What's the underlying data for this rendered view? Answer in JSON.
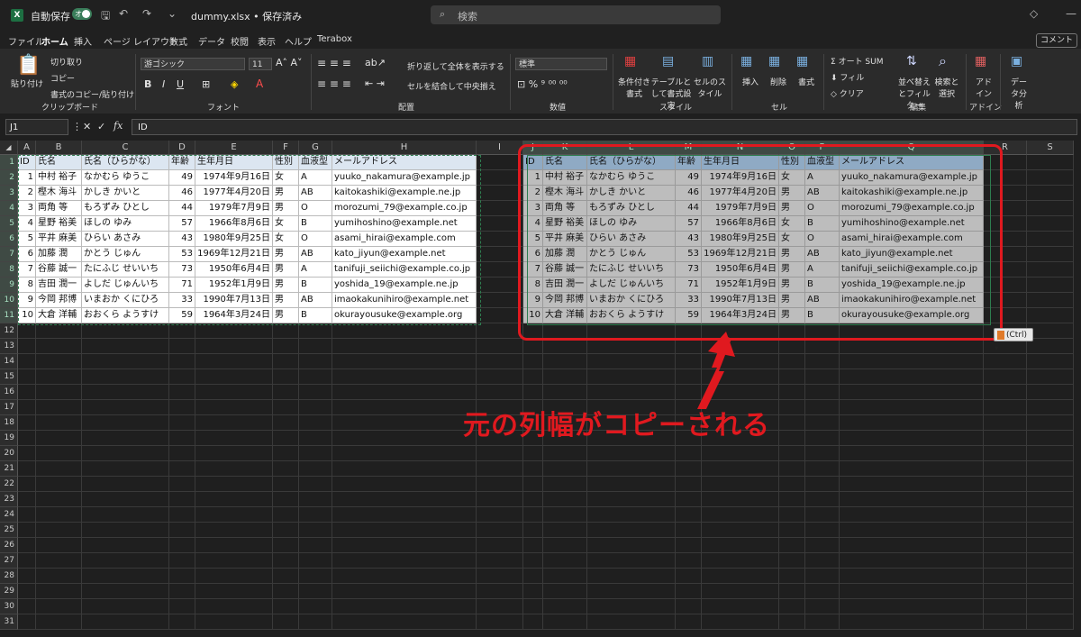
{
  "titlebar": {
    "autosave_label": "自動保存",
    "autosave_state": "オン",
    "filename": "dummy.xlsx • 保存済み",
    "search_placeholder": "検索"
  },
  "menu": {
    "tabs": [
      "ファイル",
      "ホーム",
      "挿入",
      "ページ レイアウト",
      "数式",
      "データ",
      "校閲",
      "表示",
      "ヘルプ",
      "Terabox"
    ],
    "active": "ホーム",
    "share": "コメント"
  },
  "ribbon": {
    "clipboard": {
      "paste": "貼り付け",
      "cut": "切り取り",
      "copy": "コピー",
      "format_painter": "書式のコピー/貼り付け",
      "label": "クリップボード"
    },
    "font": {
      "name": "游ゴシック",
      "size": "11",
      "label": "フォント"
    },
    "alignment": {
      "wrap": "折り返して全体を表示する",
      "merge": "セルを結合して中央揃え",
      "label": "配置"
    },
    "number": {
      "format": "標準",
      "label": "数値"
    },
    "styles": {
      "conditional": "条件付き書式",
      "table": "テーブルとして書式設定",
      "cell": "セルのスタイル",
      "label": "スタイル"
    },
    "cells": {
      "insert": "挿入",
      "delete": "削除",
      "format": "書式",
      "label": "セル"
    },
    "editing": {
      "autosum": "オート SUM",
      "fill": "フィル",
      "clear": "クリア",
      "sort": "並べ替えとフィルター",
      "find": "検索と選択",
      "label": "編集"
    },
    "addins": {
      "addin": "アドイン",
      "label": "アドイン"
    },
    "analysis": {
      "label": "データ分析"
    }
  },
  "formula_bar": {
    "name_box": "J1",
    "fx": "fx",
    "value": "ID"
  },
  "grid": {
    "columns_src": [
      "A",
      "B",
      "C",
      "D",
      "E",
      "F",
      "G",
      "H",
      "I"
    ],
    "columns_dst": [
      "J",
      "K",
      "L",
      "M",
      "N",
      "O",
      "P",
      "Q",
      "R",
      "S"
    ],
    "rows": [
      "1",
      "2",
      "3",
      "4",
      "5",
      "6",
      "7",
      "8",
      "9",
      "10",
      "11",
      "12",
      "13",
      "14",
      "15",
      "16",
      "17",
      "18",
      "19",
      "20",
      "21",
      "22",
      "23",
      "24",
      "25",
      "26",
      "27",
      "28",
      "29",
      "30",
      "31"
    ],
    "header": [
      "ID",
      "氏名",
      "氏名（ひらがな）",
      "年齢",
      "生年月日",
      "性別",
      "血液型",
      "メールアドレス"
    ],
    "records": [
      [
        "1",
        "中村 裕子",
        "なかむら ゆうこ",
        "49",
        "1974年9月16日",
        "女",
        "A",
        "yuuko_nakamura@example.jp"
      ],
      [
        "2",
        "樫木 海斗",
        "かしき かいと",
        "46",
        "1977年4月20日",
        "男",
        "AB",
        "kaitokashiki@example.ne.jp"
      ],
      [
        "3",
        "両角 等",
        "もろずみ ひとし",
        "44",
        "1979年7月9日",
        "男",
        "O",
        "morozumi_79@example.co.jp"
      ],
      [
        "4",
        "星野 裕美",
        "ほしの ゆみ",
        "57",
        "1966年8月6日",
        "女",
        "B",
        "yumihoshino@example.net"
      ],
      [
        "5",
        "平井 麻美",
        "ひらい あさみ",
        "43",
        "1980年9月25日",
        "女",
        "O",
        "asami_hirai@example.com"
      ],
      [
        "6",
        "加藤 潤",
        "かとう じゅん",
        "53",
        "1969年12月21日",
        "男",
        "AB",
        "kato_jiyun@example.net"
      ],
      [
        "7",
        "谷藤 誠一",
        "たにふじ せいいち",
        "73",
        "1950年6月4日",
        "男",
        "A",
        "tanifuji_seiichi@example.co.jp"
      ],
      [
        "8",
        "吉田 潤一",
        "よしだ じゅんいち",
        "71",
        "1952年1月9日",
        "男",
        "B",
        "yoshida_19@example.ne.jp"
      ],
      [
        "9",
        "今岡 邦博",
        "いまおか くにひろ",
        "33",
        "1990年7月13日",
        "男",
        "AB",
        "imaokakunihiro@example.net"
      ],
      [
        "10",
        "大倉 洋輔",
        "おおくら ようすけ",
        "59",
        "1964年3月24日",
        "男",
        "B",
        "okurayousuke@example.org"
      ]
    ]
  },
  "paste_options": "(Ctrl)",
  "annotation": "元の列幅がコピーされる",
  "colors": {
    "accent": "#e0191f",
    "excel_green": "#2e7d4f"
  }
}
